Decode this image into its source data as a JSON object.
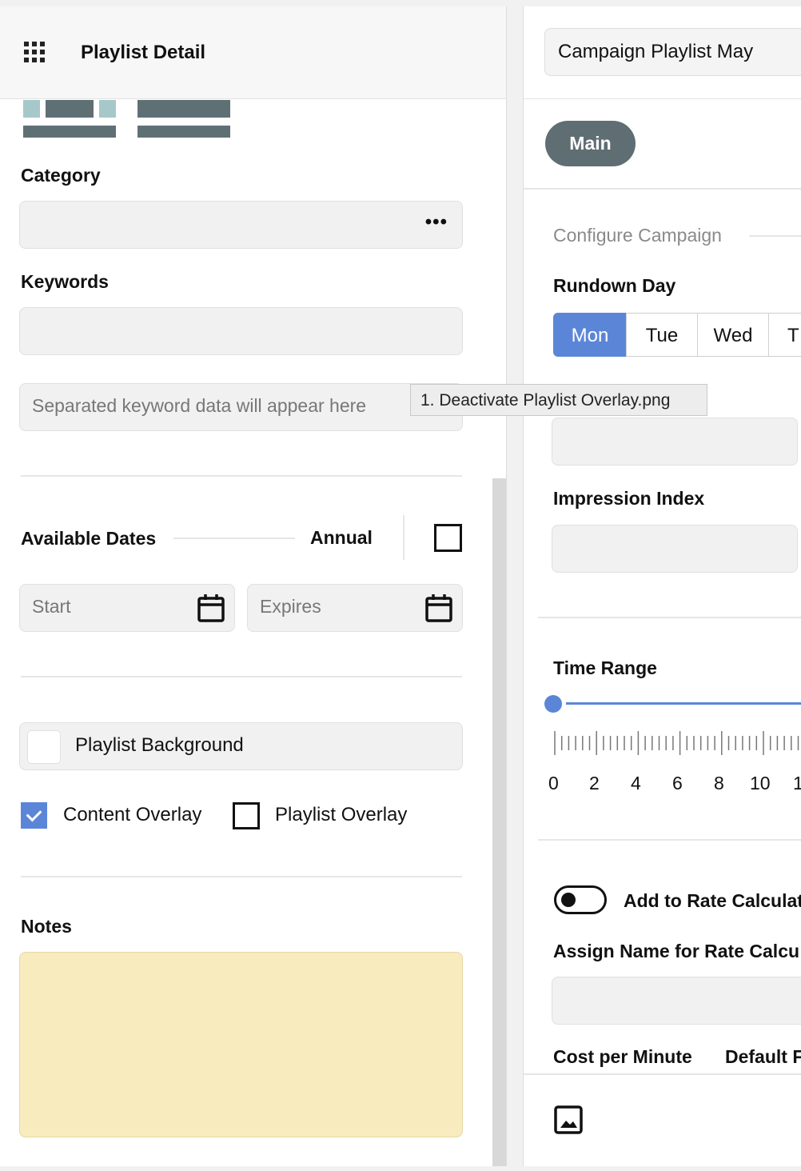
{
  "header": {
    "title": "Playlist Detail",
    "menu_icon": "grid-icon"
  },
  "category": {
    "label": "Category",
    "value": "",
    "more_icon": "ellipsis-icon"
  },
  "keywords": {
    "label": "Keywords",
    "value": "",
    "placeholder": "Separated keyword data will appear here"
  },
  "available_dates": {
    "label": "Available Dates",
    "annual_label": "Annual",
    "annual_checked": false,
    "start_placeholder": "Start",
    "expires_placeholder": "Expires"
  },
  "background": {
    "label": "Playlist Background"
  },
  "overlays": {
    "content_label": "Content Overlay",
    "content_checked": true,
    "playlist_label": "Playlist Overlay",
    "playlist_checked": false
  },
  "notes": {
    "label": "Notes",
    "value": "",
    "color": "#f8ecbf"
  },
  "right": {
    "playlist_select": "Campaign Playlist May",
    "tab_main": "Main",
    "section_title": "Configure Campaign",
    "rundown_label": "Rundown Day",
    "days": [
      "Mon",
      "Tue",
      "Wed",
      "T"
    ],
    "active_day": "Mon",
    "impression_label": "Impression Index",
    "time_range_label": "Time Range",
    "time_ticks": [
      "0",
      "2",
      "4",
      "6",
      "8",
      "10",
      "1"
    ],
    "rate_toggle_label": "Add to Rate Calculat",
    "assign_label": "Assign Name for Rate Calcu",
    "cost_label": "Cost per Minute",
    "default_label": "Default F",
    "image_icon": "image-icon"
  },
  "tooltip": {
    "text": "1. Deactivate Playlist Overlay.png"
  },
  "colors": {
    "accent": "#5b86d8",
    "pill": "#5f6e73",
    "thumb_dark": "#5f7075",
    "thumb_light": "#a6c8c8"
  }
}
